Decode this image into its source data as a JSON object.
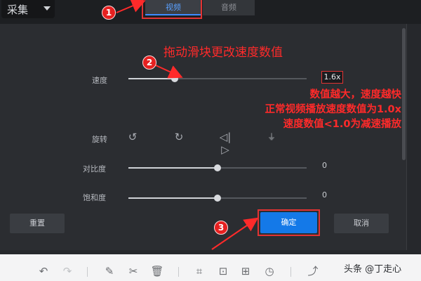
{
  "top_bar": {
    "capture_label": "采集"
  },
  "tabs": [
    {
      "label": "视频",
      "active": true
    },
    {
      "label": "音频",
      "active": false
    }
  ],
  "speed": {
    "label": "速度",
    "value": "1.6x",
    "fraction": 0.26
  },
  "rotate": {
    "label": "旋转",
    "icons": [
      "rotate-left-icon",
      "rotate-right-icon",
      "flip-horizontal-icon",
      "flip-vertical-icon"
    ]
  },
  "contrast": {
    "label": "对比度",
    "value": "0",
    "fraction": 0.5
  },
  "saturation": {
    "label": "饱和度",
    "value": "0",
    "fraction": 0.5
  },
  "buttons": {
    "reset": "重置",
    "confirm": "确定",
    "cancel": "取消"
  },
  "annotations": {
    "badge1": "1",
    "badge2": "2",
    "badge3": "3",
    "drag_hint": "拖动滑块更改速度数值",
    "note_line1": "数值越大，速度越快",
    "note_line2": "正常视频播放速度数值为1.0x",
    "note_line3": "速度数值<1.0为减速播放"
  },
  "toolbar": {
    "icons": [
      "undo-icon",
      "redo-icon",
      "pen-icon",
      "scissors-icon",
      "trash-icon",
      "crop-icon",
      "fit-icon",
      "split-icon",
      "clock-icon",
      "share-icon"
    ]
  },
  "watermark": "头条 @丁走心",
  "colors": {
    "accent": "#1479e8",
    "annotation": "#ff2a2a",
    "panel": "#2b2d31"
  }
}
